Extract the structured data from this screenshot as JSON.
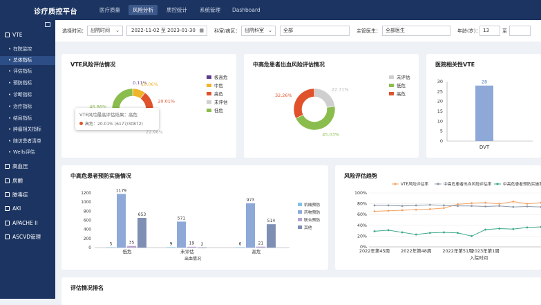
{
  "app_title": "诊疗质控平台",
  "top_nav": [
    {
      "label": "医疗质量",
      "active": false
    },
    {
      "label": "风险分析",
      "active": true
    },
    {
      "label": "质控统计",
      "active": false
    },
    {
      "label": "系统管理",
      "active": false
    },
    {
      "label": "Dashboard",
      "active": false
    }
  ],
  "sidebar": {
    "group_vte": "VTE",
    "vte_items": [
      {
        "label": "在院监控",
        "active": false
      },
      {
        "label": "总体指标",
        "active": true
      },
      {
        "label": "评估指标",
        "active": false
      },
      {
        "label": "预防指标",
        "active": false
      },
      {
        "label": "诊断指标",
        "active": false
      },
      {
        "label": "治疗指标",
        "active": false
      },
      {
        "label": "结局指标",
        "active": false
      },
      {
        "label": "肿瘤相关指标",
        "active": false
      },
      {
        "label": "随访患者清单",
        "active": false
      },
      {
        "label": "Wells评估",
        "active": false
      }
    ],
    "groups": [
      "高血压",
      "房颤",
      "脓毒症",
      "AKI",
      "APACHE II",
      "ASCVD管理"
    ]
  },
  "filters": {
    "time_label": "选择时间：",
    "time_type": "出院时间",
    "date_start": "2022-11-02",
    "date_sep": "至",
    "date_end": "2023-01-30",
    "dept_label": "科室/病区：",
    "dept_type": "出院科室",
    "dept_value": "全部",
    "doctor_label": "主管医生：",
    "doctor_value": "全部医生",
    "age_label": "年龄(岁)：",
    "age_min": "13",
    "age_sep": "至",
    "age_max": ""
  },
  "vte_card": {
    "title": "VTE风险评估情况",
    "legend": [
      {
        "label": "极高危",
        "color": "#5b3a8f"
      },
      {
        "label": "中危",
        "color": "#f0b429"
      },
      {
        "label": "高危",
        "color": "#e0522b"
      },
      {
        "label": "未评估",
        "color": "#cfcfcf"
      },
      {
        "label": "低危",
        "color": "#8bbd4e"
      }
    ],
    "tooltip_title": "VTE风险最高评估结果：高危",
    "tooltip_value": "高危：20.01% (6177/30872)"
  },
  "bleed_card": {
    "title": "中高危患者出血风险评估情况",
    "legend": [
      {
        "label": "未评估",
        "color": "#cfcfcf"
      },
      {
        "label": "低危",
        "color": "#8bbd4e"
      },
      {
        "label": "高危",
        "color": "#e0522b"
      }
    ]
  },
  "hospital_card": {
    "title": "医院相关性VTE"
  },
  "prevent_card": {
    "title": "中高危患者预防实施情况",
    "x_title": "出血情况"
  },
  "trend_card": {
    "title": "风险评估趋势",
    "x_title": "入院时间"
  },
  "ranking_card": {
    "title": "评估情况排名"
  },
  "chart_data": [
    {
      "type": "pie",
      "title": "VTE风险评估情况",
      "categories": [
        "极高危",
        "中危",
        "高危",
        "未评估",
        "低危"
      ],
      "values": [
        0.11,
        10.06,
        20.01,
        22.96,
        46.86
      ],
      "labels": [
        "0.11%",
        "10.06%",
        "20.01%",
        "22.96%",
        "46.86%"
      ],
      "colors": [
        "#5b3a8f",
        "#f0b429",
        "#e0522b",
        "#cfcfcf",
        "#8bbd4e"
      ],
      "legend": "right"
    },
    {
      "type": "pie",
      "title": "中高危患者出血风险评估情况",
      "categories": [
        "未评估",
        "低危",
        "高危"
      ],
      "values": [
        22.71,
        45.03,
        32.26
      ],
      "labels": [
        "22.71%",
        "45.03%",
        "32.26%"
      ],
      "colors": [
        "#cfcfcf",
        "#8bbd4e",
        "#e0522b"
      ],
      "legend": "top-right"
    },
    {
      "type": "bar",
      "title": "医院相关性VTE",
      "categories": [
        "DVT"
      ],
      "values": [
        28
      ],
      "ylim": [
        0,
        30
      ],
      "yticks": [
        0,
        5,
        10,
        15,
        20,
        25,
        30
      ],
      "color": "#8ea9d8"
    },
    {
      "type": "bar",
      "title": "中高危患者预防实施情况",
      "xlabel": "出血情况",
      "categories": [
        "低危",
        "未评估",
        "高危"
      ],
      "ylim": [
        0,
        1200
      ],
      "yticks": [
        0,
        200,
        400,
        600,
        800,
        1000,
        1200
      ],
      "series": [
        {
          "name": "机械预防",
          "values": [
            5,
            9,
            6
          ],
          "color": "#7ec3e6"
        },
        {
          "name": "药物预防",
          "values": [
            1179,
            571,
            973
          ],
          "color": "#8ea9d8"
        },
        {
          "name": "联合预防",
          "values": [
            35,
            19,
            21
          ],
          "color": "#b5a3d0"
        },
        {
          "name": "其他",
          "values": [
            653,
            2,
            514
          ],
          "color": "#7f8fb4"
        }
      ],
      "legend": "right"
    },
    {
      "type": "line",
      "title": "风险评估趋势",
      "xlabel": "入院时间",
      "x": [
        "2022年第45周",
        "2022年第46周",
        "2022年第47周",
        "2022年第48周",
        "2022年第49周",
        "2022年第50周",
        "2022年第51周",
        "2022年第52周",
        "2023年第1周",
        "2023年第2周",
        "2023年第3周",
        "2023年第4周",
        "2023年第5周"
      ],
      "xticks": [
        "2022年第45周",
        "2022年第48周",
        "2022年第51周",
        "2023年第1周"
      ],
      "ylim": [
        0,
        100
      ],
      "yticks": [
        "0%",
        "20%",
        "40%",
        "60%",
        "80%",
        "100%"
      ],
      "series": [
        {
          "name": "VTE风险评估率",
          "values": [
            66,
            67,
            68,
            69,
            70,
            72,
            79,
            81,
            82,
            80,
            84,
            80,
            82
          ],
          "color": "#f4a261"
        },
        {
          "name": "中高危患者出血风险评估率",
          "values": [
            77,
            77,
            76,
            77,
            78,
            77,
            76,
            76,
            75,
            76,
            74,
            75,
            74
          ],
          "color": "#8a96a8"
        },
        {
          "name": "中高危患者预防实施率",
          "values": [
            29,
            31,
            27,
            23,
            26,
            27,
            26,
            20,
            32,
            34,
            33,
            36,
            37
          ],
          "color": "#3aa88a"
        }
      ],
      "legend": "top"
    }
  ]
}
